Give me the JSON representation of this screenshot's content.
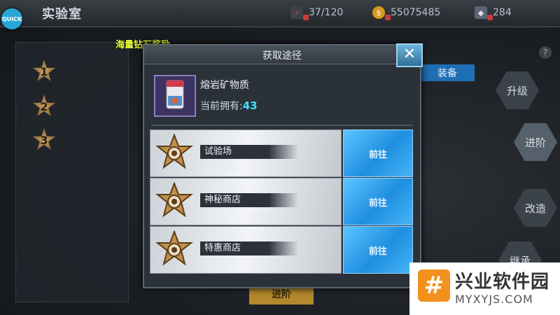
{
  "app": {
    "quick_label": "QUICK",
    "title": "实验室"
  },
  "resources": [
    {
      "icon": "energy-icon",
      "value": "37/120"
    },
    {
      "icon": "gold-coin-icon",
      "value": "55075485"
    },
    {
      "icon": "diamond-icon",
      "value": "284"
    }
  ],
  "promo": "海量钻石奖励",
  "left_menu": [
    {
      "label": "1"
    },
    {
      "label": "2"
    },
    {
      "label": "3"
    }
  ],
  "right_menu": {
    "tag": "装备",
    "buttons": [
      "升级",
      "进阶",
      "改造",
      "继承"
    ],
    "help": "?"
  },
  "bottom_button": "进阶",
  "dialog": {
    "title": "获取途径",
    "close_label": "✕",
    "item_name": "熔岩矿物质",
    "owned_label": "当前拥有:",
    "owned_value": "43",
    "sources": [
      {
        "name": "试验场",
        "action": "前往"
      },
      {
        "name": "神秘商店",
        "action": "前往"
      },
      {
        "name": "特惠商店",
        "action": "前往"
      }
    ]
  },
  "watermark": {
    "logo": "#",
    "name": "兴业软件园",
    "url": "MYXYJS.COM"
  }
}
